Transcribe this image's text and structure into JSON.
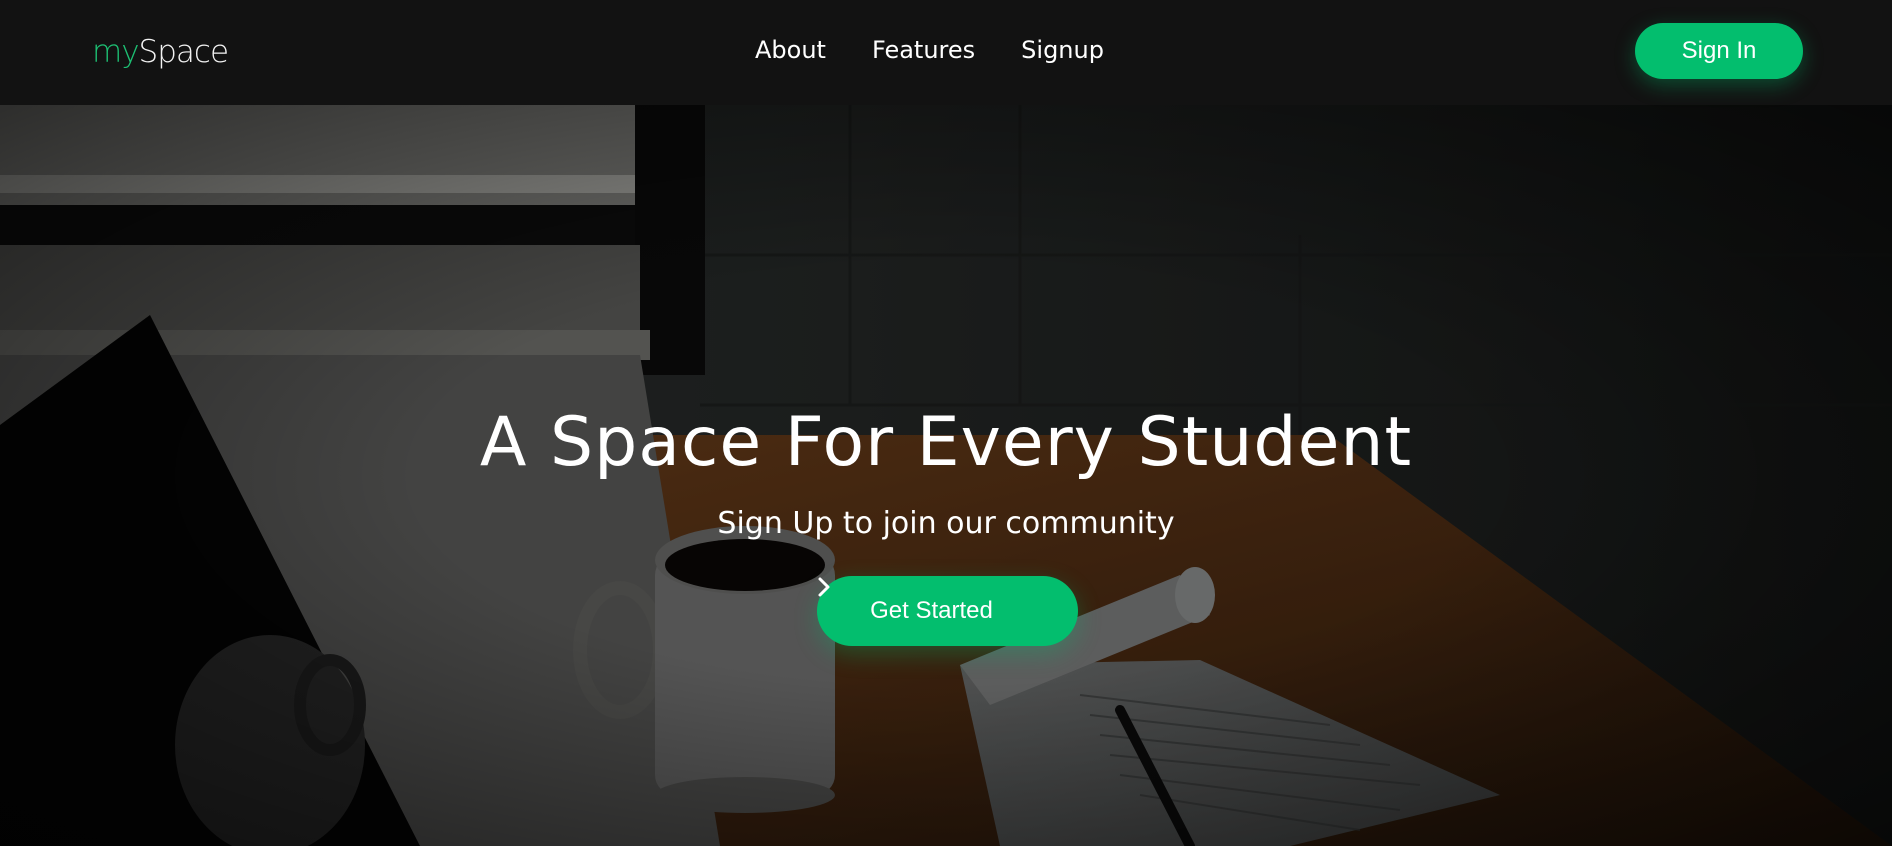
{
  "brand": {
    "prefix": "my",
    "name": "Space"
  },
  "nav": {
    "links": [
      {
        "label": "About"
      },
      {
        "label": "Features"
      },
      {
        "label": "Signup"
      }
    ],
    "signin_label": "Sign In"
  },
  "hero": {
    "title": "A Space For Every Student",
    "subtitle": "Sign Up to join our community",
    "cta_label": "Get Started",
    "cta_icon": "chevron-right-icon",
    "background": "desk-with-coffee-mug-notepad-and-laptop-photo"
  },
  "colors": {
    "accent": "#03be6e",
    "navbar": "#121212",
    "text": "#ffffff"
  }
}
